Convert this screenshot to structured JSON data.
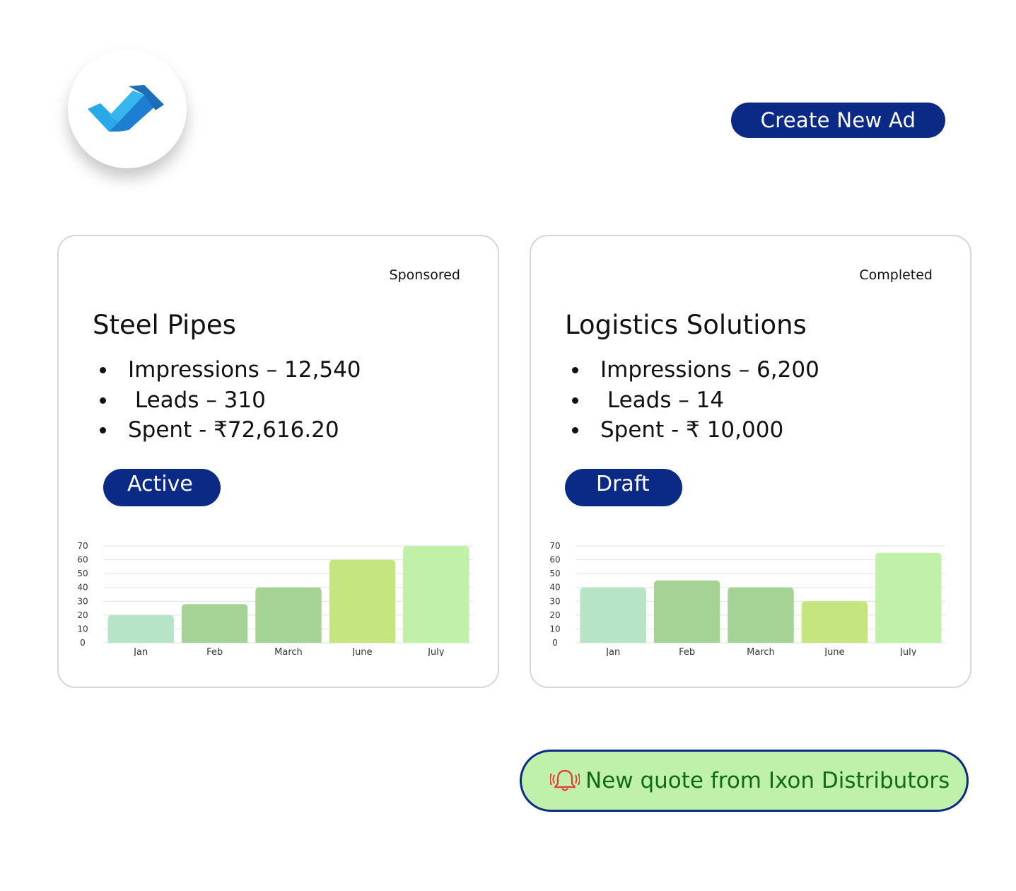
{
  "header": {
    "logo_icon": "brand-logo-icon",
    "create_button_label": "Create New Ad"
  },
  "cards": [
    {
      "tag": "Sponsored",
      "title": "Steel Pipes",
      "metrics": [
        "Impressions – 12,540",
        " Leads – 310",
        "Spent - ₹72,616.20"
      ],
      "status": "Active"
    },
    {
      "tag": "Completed",
      "title": "Logistics Solutions",
      "metrics": [
        "Impressions – 6,200",
        " Leads – 14",
        "Spent - ₹ 10,000"
      ],
      "status": "Draft"
    }
  ],
  "chart_data": [
    {
      "type": "bar",
      "categories": [
        "Jan",
        "Feb",
        "March",
        "June",
        "July"
      ],
      "values": [
        20,
        28,
        40,
        60,
        70
      ],
      "ylim": [
        0,
        70
      ],
      "yticks": [
        0,
        10,
        20,
        30,
        40,
        50,
        60,
        70
      ],
      "grid": true,
      "colors": [
        "#b7e4c7",
        "#a5d396",
        "#a5d396",
        "#c5e67f",
        "#c1f1a8"
      ]
    },
    {
      "type": "bar",
      "categories": [
        "Jan",
        "Feb",
        "March",
        "June",
        "July"
      ],
      "values": [
        40,
        45,
        40,
        30,
        65
      ],
      "ylim": [
        0,
        70
      ],
      "yticks": [
        0,
        10,
        20,
        30,
        40,
        50,
        60,
        70
      ],
      "grid": true,
      "colors": [
        "#b7e4c7",
        "#a5d396",
        "#a5d396",
        "#c5e67f",
        "#c1f1a8"
      ]
    }
  ],
  "notification": {
    "icon": "bell-ringing-icon",
    "text": "New quote from Ixon Distributors"
  },
  "colors": {
    "brand_navy": "#0b2a86",
    "notification_bg": "#c0f1aa",
    "notification_text": "#0e6d14",
    "bell_red": "#e53935"
  }
}
